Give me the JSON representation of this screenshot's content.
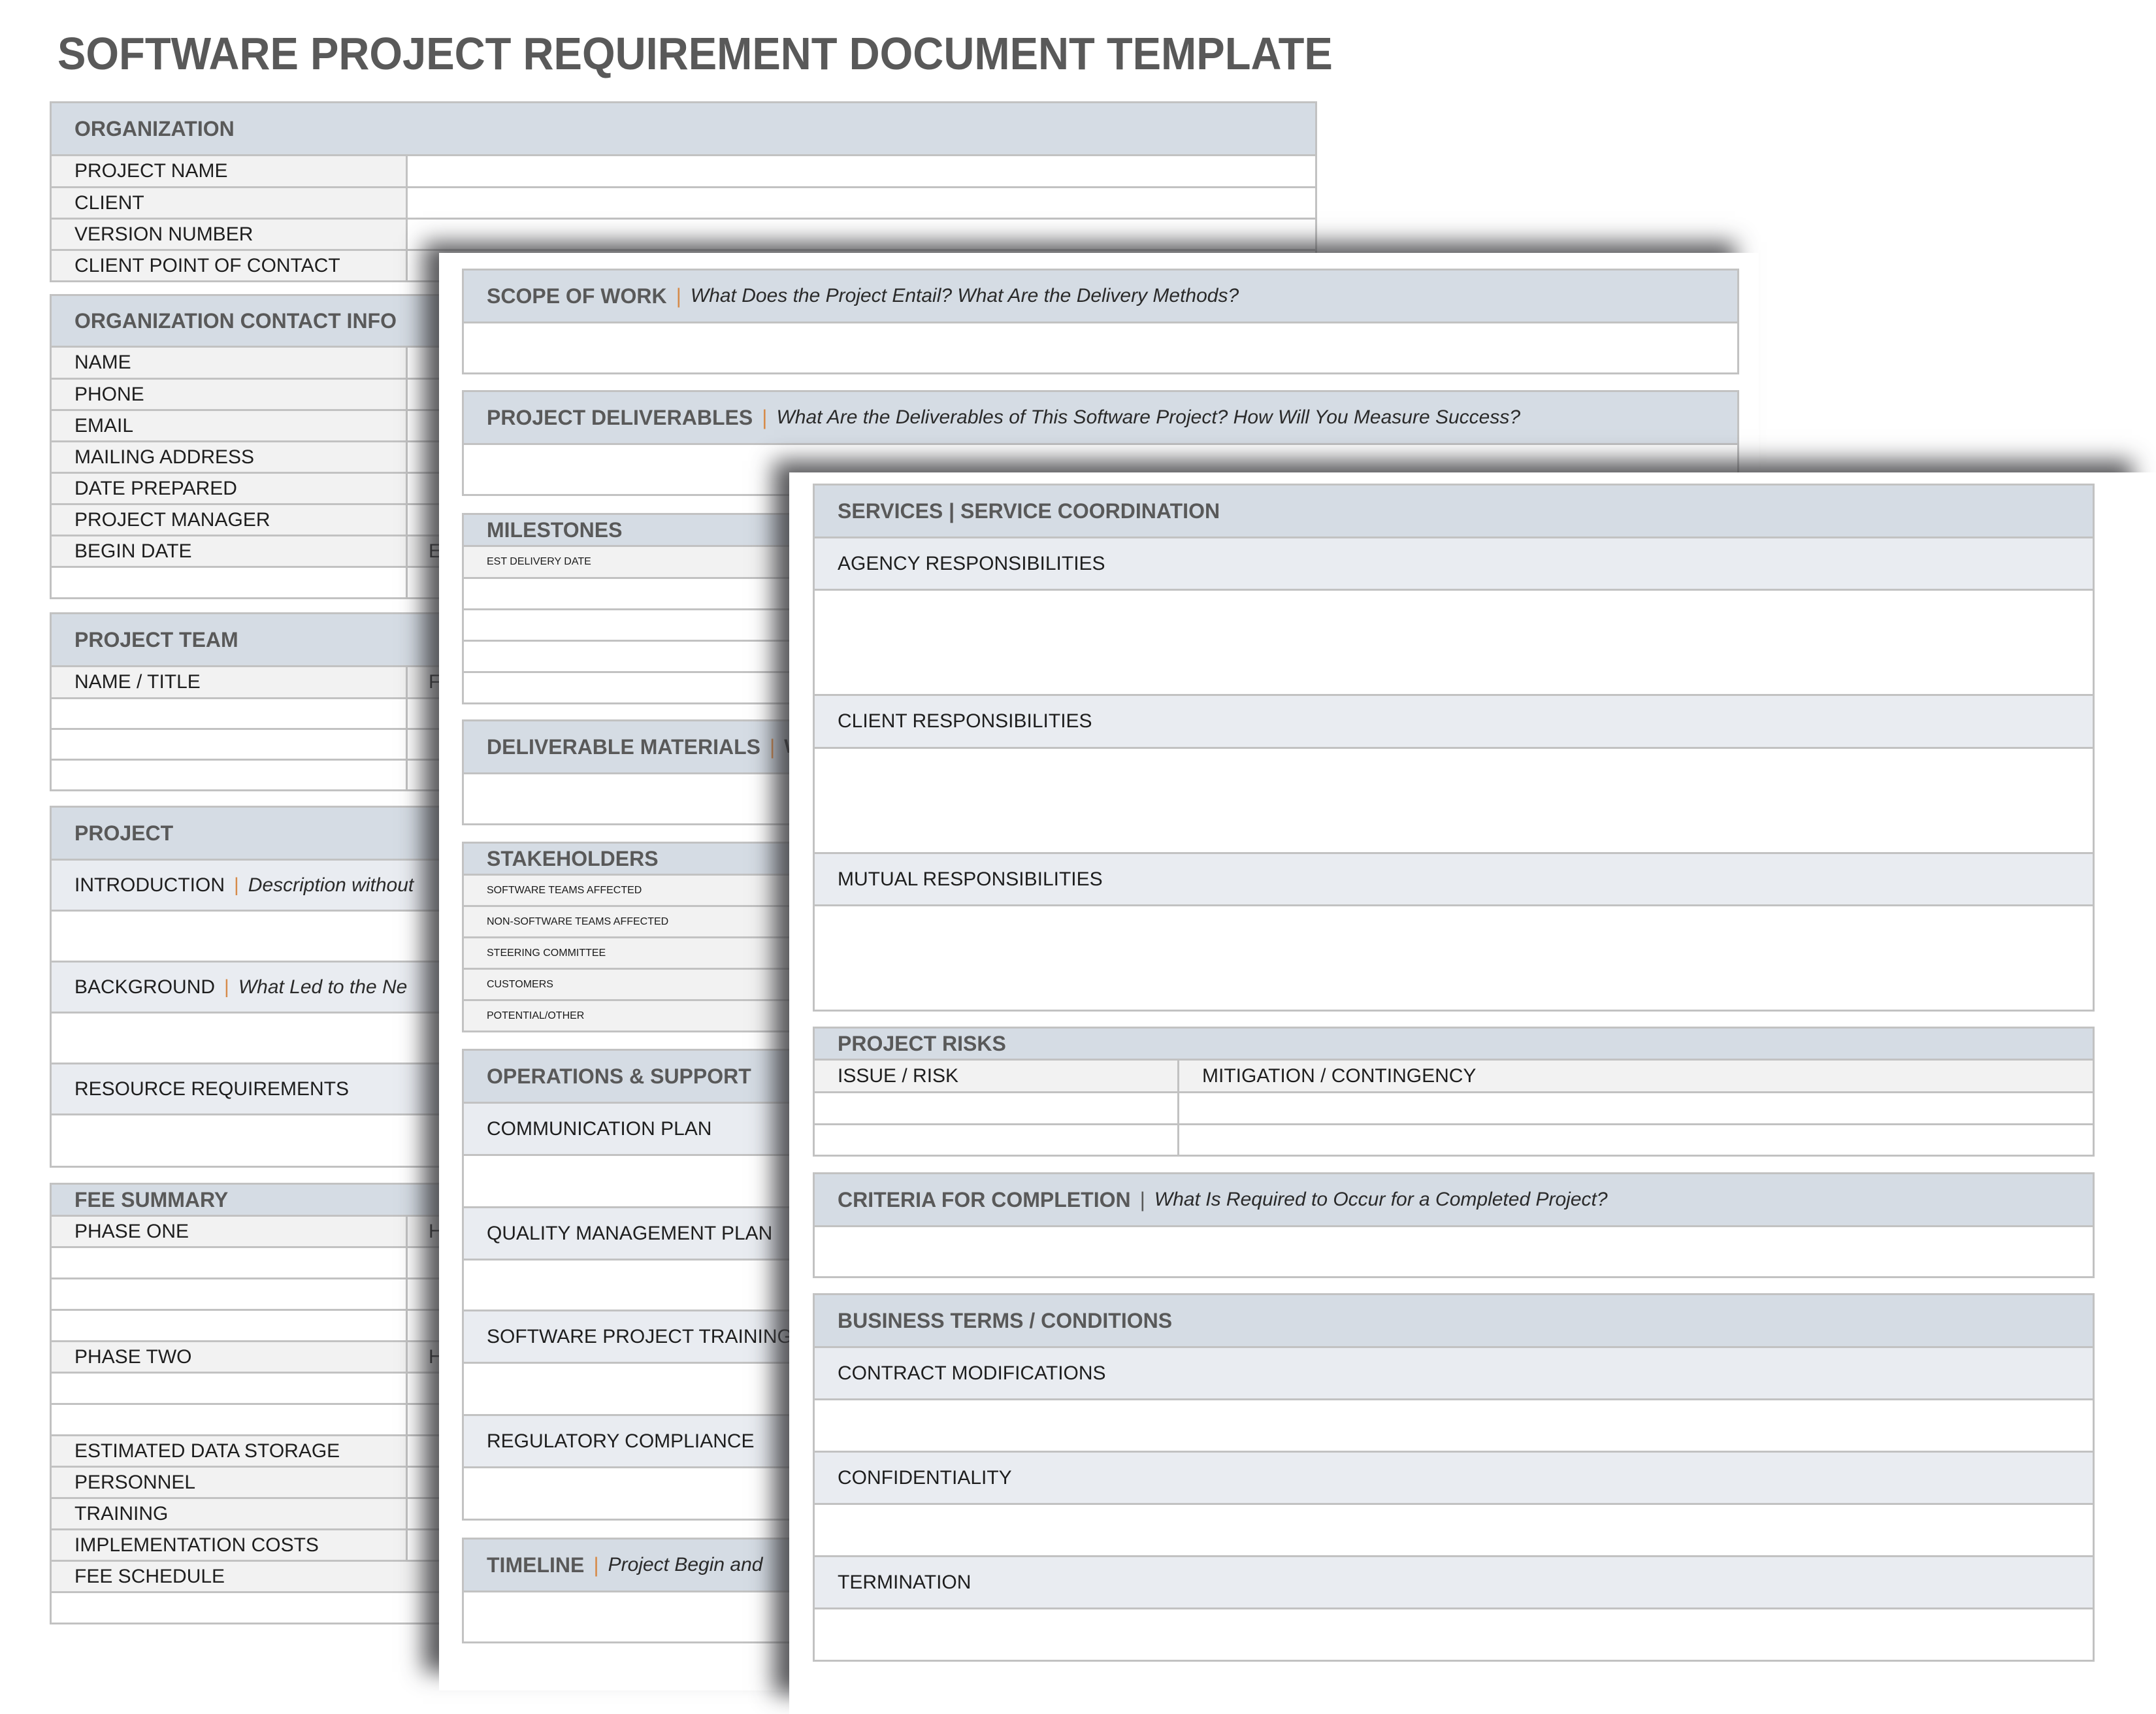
{
  "title": "SOFTWARE PROJECT REQUIREMENT DOCUMENT TEMPLATE",
  "page1": {
    "organization": {
      "header": "ORGANIZATION",
      "rows": [
        "PROJECT NAME",
        "CLIENT",
        "VERSION NUMBER",
        "CLIENT POINT OF CONTACT"
      ]
    },
    "contact": {
      "header": "ORGANIZATION CONTACT INFO",
      "rows": [
        "NAME",
        "PHONE",
        "EMAIL",
        "MAILING ADDRESS",
        "DATE PREPARED",
        "PROJECT MANAGER",
        "BEGIN DATE",
        ""
      ],
      "begin_date_right_partial": "E"
    },
    "team": {
      "header": "PROJECT TEAM",
      "rows": [
        "NAME / TITLE",
        "",
        "",
        ""
      ],
      "name_title_right_partial": "F"
    },
    "project": {
      "header": "PROJECT",
      "introduction": {
        "label": "INTRODUCTION",
        "hint": "Description without"
      },
      "background": {
        "label": "BACKGROUND",
        "hint": "What Led to the Ne"
      },
      "resources": {
        "label": "RESOURCE REQUIREMENTS"
      }
    },
    "fees": {
      "header": "FEE SUMMARY",
      "rows": [
        "PHASE ONE",
        "",
        "",
        "",
        "PHASE TWO",
        "",
        "",
        "ESTIMATED DATA STORAGE",
        "PERSONNEL",
        "TRAINING",
        "IMPLEMENTATION COSTS",
        "FEE SCHEDULE",
        ""
      ],
      "phase_right_partial": "H"
    },
    "pipe": "|"
  },
  "page2": {
    "scope": {
      "label": "SCOPE OF WORK",
      "hint": "What Does the Project Entail? What Are the Delivery Methods?"
    },
    "deliverables": {
      "label": "PROJECT DELIVERABLES",
      "hint": "What Are the Deliverables of This Software Project? How Will You Measure Success?"
    },
    "milestones": {
      "header": "MILESTONES",
      "rows": [
        "EST DELIVERY DATE",
        "",
        "",
        "",
        ""
      ]
    },
    "materials": {
      "label": "DELIVERABLE MATERIALS",
      "hint": "W"
    },
    "stakeholders": {
      "header": "STAKEHOLDERS",
      "rows": [
        "SOFTWARE TEAMS AFFECTED",
        "NON-SOFTWARE TEAMS AFFECTED",
        "STEERING COMMITTEE",
        "CUSTOMERS",
        "POTENTIAL/OTHER"
      ]
    },
    "operations": {
      "header": "OPERATIONS & SUPPORT",
      "items": [
        "COMMUNICATION PLAN",
        "QUALITY MANAGEMENT PLAN",
        "SOFTWARE PROJECT TRAINING",
        "REGULATORY COMPLIANCE"
      ]
    },
    "timeline": {
      "label": "TIMELINE",
      "hint": "Project Begin and"
    }
  },
  "page3": {
    "services": {
      "header": "SERVICES | SERVICE COORDINATION",
      "items": [
        "AGENCY RESPONSIBILITIES",
        "CLIENT RESPONSIBILITIES",
        "MUTUAL RESPONSIBILITIES"
      ]
    },
    "risks": {
      "header": "PROJECT RISKS",
      "col1": "ISSUE / RISK",
      "col2": "MITIGATION / CONTINGENCY"
    },
    "criteria": {
      "label": "CRITERIA FOR COMPLETION",
      "hint": "What Is Required to Occur for a Completed Project?"
    },
    "terms": {
      "header": "BUSINESS TERMS / CONDITIONS",
      "items": [
        "CONTRACT MODIFICATIONS",
        "CONFIDENTIALITY",
        "TERMINATION"
      ]
    }
  },
  "colors": {
    "header_bg": "#d5dce4",
    "subheader_bg": "#e9ecf1",
    "label_bg": "#f2f2f2",
    "border": "#c2c2c2",
    "title": "#595959",
    "pipe_accent": "#d68b4a"
  }
}
